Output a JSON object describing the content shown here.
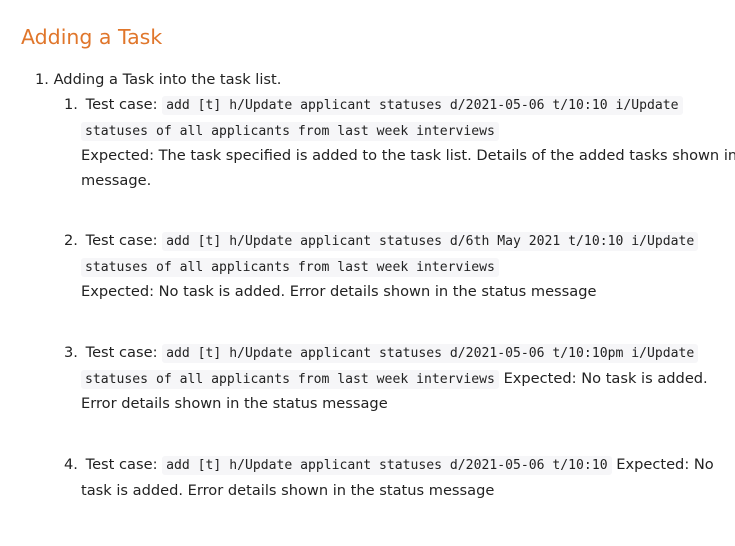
{
  "section": {
    "title": "Adding a Task"
  },
  "steps": [
    {
      "number": "1.",
      "text": "Adding a Task into the task list."
    }
  ],
  "test_cases": [
    {
      "number": "1.",
      "label": "Test case:",
      "command_line1": "add [t] h/Update applicant statuses d/2021-05-06 t/10:10 i/Update",
      "command_line2": "statuses of all applicants from last week interviews",
      "expected_line1": "Expected: The task specified is added to the task list. Details of the added tasks shown in a",
      "expected_line2": "message."
    },
    {
      "number": "2.",
      "label": "Test case:",
      "command_line1": "add [t] h/Update applicant statuses d/6th May 2021 t/10:10 i/Update",
      "command_line2": "statuses of all applicants from last week interviews",
      "expected_line1": "Expected: No task is added. Error details shown in the status message"
    },
    {
      "number": "3.",
      "label": "Test case:",
      "command_line1": "add [t] h/Update applicant statuses d/2021-05-06 t/10:10pm i/Update",
      "command_line2": "statuses of all applicants from last week interviews",
      "expected_inline": "Expected: No task is added.",
      "expected_line2": "Error details shown in the status message"
    },
    {
      "number": "4.",
      "label": "Test case:",
      "command_line1": "add [t] h/Update applicant statuses d/2021-05-06 t/10:10",
      "expected_inline": "Expected: No",
      "expected_line2": "task is added. Error details shown in the status message"
    }
  ]
}
